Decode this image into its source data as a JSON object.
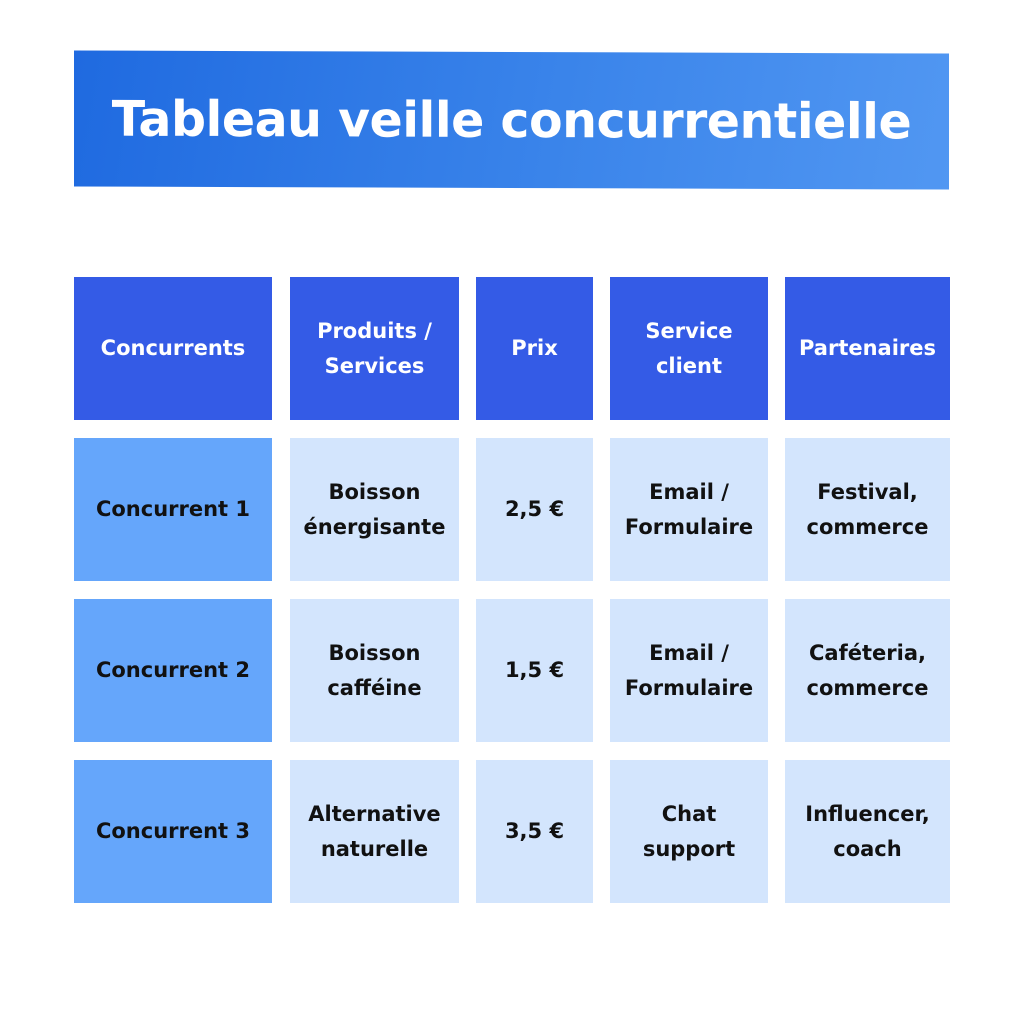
{
  "title": "Tableau veille concurrentielle",
  "colors": {
    "header": "#345be6",
    "row_header": "#65a6fb",
    "cell": "#d3e5fd",
    "banner": "#2f78e6"
  },
  "table": {
    "headers": [
      "Concurrents",
      "Produits /\nServices",
      "Prix",
      "Service\nclient",
      "Partenaires"
    ],
    "rows": [
      [
        "Concurrent 1",
        "Boisson\nénergisante",
        "2,5 €",
        "Email /\nFormulaire",
        "Festival,\ncommerce"
      ],
      [
        "Concurrent 2",
        "Boisson\ncafféine",
        "1,5 €",
        "Email /\nFormulaire",
        "Caféteria,\ncommerce"
      ],
      [
        "Concurrent 3",
        "Alternative\nnaturelle",
        "3,5 €",
        "Chat\nsupport",
        "Influencer,\ncoach"
      ]
    ]
  }
}
